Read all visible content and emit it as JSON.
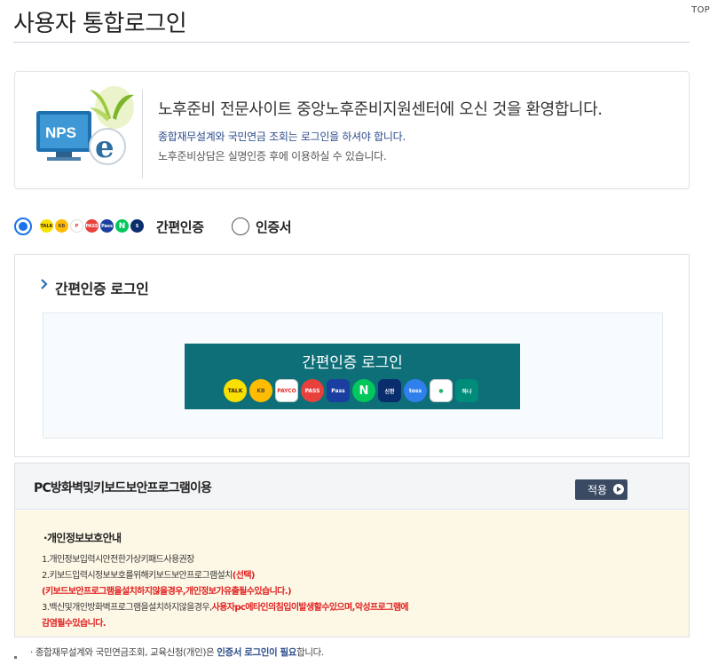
{
  "top_link": "TOP",
  "page_title": "사용자 통합로그인",
  "welcome": {
    "logo_text": "NPS",
    "main": "노후준비 전문사이트 중앙노후준비지원센터에 오신 것을 환영합니다.",
    "sub1": "종합재무설계와 국민연금 조회는 로그인을 하셔야 합니다.",
    "sub2": "노후준비상담은 실명인증 후에 이용하실 수 있습니다."
  },
  "login_options": {
    "easy_label": "간편인증",
    "cert_label": "인증서",
    "selected": "easy"
  },
  "easy_panel": {
    "heading": "간편인증 로그인",
    "button_label": "간편인증 로그인",
    "providers": [
      {
        "name": "kakao",
        "text": "TALK",
        "bg": "#f9e000",
        "fg": "#3b1e1e"
      },
      {
        "name": "kb",
        "text": "KB",
        "bg": "#ffbc00",
        "fg": "#594a36"
      },
      {
        "name": "payco",
        "text": "PAYCO",
        "bg": "#ffffff",
        "fg": "#e62e2e"
      },
      {
        "name": "pass",
        "text": "PASS",
        "bg": "#e8413d",
        "fg": "#ffffff"
      },
      {
        "name": "samsung-pass",
        "text": "Pass",
        "bg": "#1b3fa0",
        "fg": "#ffffff"
      },
      {
        "name": "naver",
        "text": "N",
        "bg": "#03c75a",
        "fg": "#ffffff"
      },
      {
        "name": "shinhan",
        "text": "신한",
        "bg": "#0a2d6e",
        "fg": "#ffffff"
      },
      {
        "name": "toss",
        "text": "toss",
        "bg": "#2f80ed",
        "fg": "#ffffff"
      },
      {
        "name": "banksalad",
        "text": "●",
        "bg": "#ffffff",
        "fg": "#26b36a"
      },
      {
        "name": "hana",
        "text": "하나",
        "bg": "#008c7a",
        "fg": "#ffffff"
      }
    ]
  },
  "security": {
    "title": "PC방화벽및키보드보안프로그램이용",
    "apply_label": "적용",
    "privacy_title": "·개인정보보호안내",
    "line1": "1.개인정보입력시안전한가상키패드사용권장",
    "line2a": "2.키보드입력시정보보호를위해키보드보안프로그램설치",
    "line2b": "(선택)",
    "line3": "(키보드보안프로그램을설치하지않을경우,개인정보가유출될수있습니다.)",
    "line4a": "3.백신및개인방화벽프로그램을설치하지않을경우,",
    "line4b": "사용자pc에타인의침입이발생할수있으며,악성프로그램에",
    "line5": "감염될수있습니다."
  },
  "footnote": {
    "prefix": "· 종합재무설계와 국민연금조회, 교육신청(개인)은 ",
    "highlight": "인증서 로그인이 필요",
    "suffix": "합니다."
  }
}
